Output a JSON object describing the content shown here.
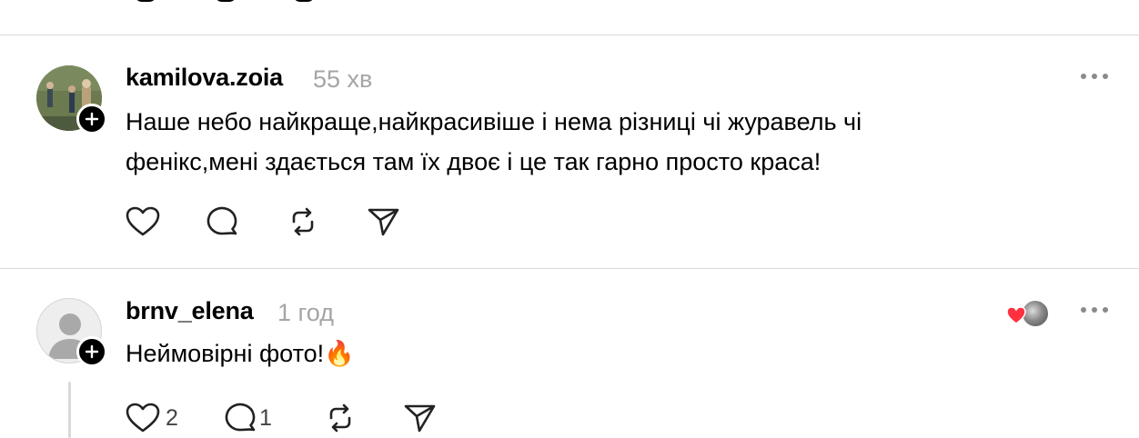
{
  "posts": [
    {
      "username": "kamilova.zoia",
      "time": "55 хв",
      "text_line1": "Наше небо найкраще,найкрасивіше і нема різниці чі журавель чі",
      "text_line2": "фенікс,мені здається там їх двоє і це так гарно просто краса!",
      "like_count": "",
      "reply_count": ""
    },
    {
      "username": "brnv_elena",
      "time": "1 год",
      "text_line1": "Неймовірні фото!🔥",
      "like_count": "2",
      "reply_count": "1"
    }
  ],
  "icons": [
    "heart-icon",
    "comment-icon",
    "repost-icon",
    "share-icon",
    "more-icon",
    "plus-icon"
  ],
  "colors": {
    "divider": "#d9d9d9",
    "muted_text": "#a5a5a5",
    "reaction_heart": "#ff3040"
  }
}
